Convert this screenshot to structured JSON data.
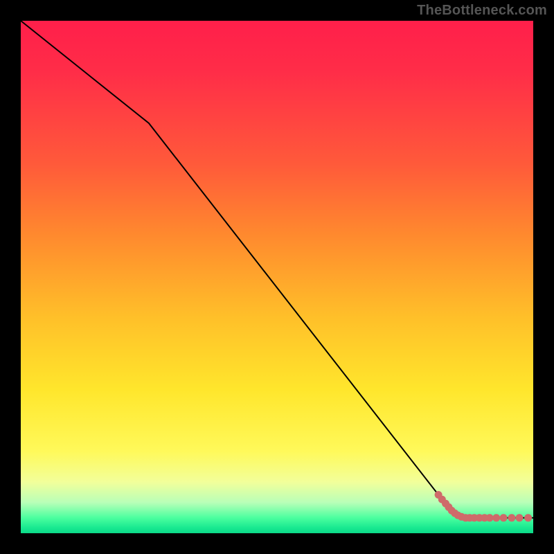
{
  "watermark": "TheBottleneck.com",
  "chart_data": {
    "type": "line",
    "title": "",
    "xlabel": "",
    "ylabel": "",
    "xlim": [
      0,
      100
    ],
    "ylim": [
      0,
      100
    ],
    "grid": false,
    "legend": false,
    "series": [
      {
        "name": "curve",
        "x": [
          0,
          25,
          85,
          100
        ],
        "values": [
          100,
          80,
          3,
          3
        ]
      }
    ],
    "scatter": {
      "name": "tail-points",
      "color": "#cf6a6a",
      "points": [
        {
          "x": 81.5,
          "y": 7.5
        },
        {
          "x": 82.2,
          "y": 6.6
        },
        {
          "x": 82.9,
          "y": 5.8
        },
        {
          "x": 83.5,
          "y": 5.1
        },
        {
          "x": 84.1,
          "y": 4.4
        },
        {
          "x": 84.7,
          "y": 3.9
        },
        {
          "x": 85.3,
          "y": 3.5
        },
        {
          "x": 86.0,
          "y": 3.2
        },
        {
          "x": 86.8,
          "y": 3.0
        },
        {
          "x": 87.6,
          "y": 3.0
        },
        {
          "x": 88.5,
          "y": 3.0
        },
        {
          "x": 89.5,
          "y": 3.0
        },
        {
          "x": 90.5,
          "y": 3.0
        },
        {
          "x": 91.5,
          "y": 3.0
        },
        {
          "x": 92.8,
          "y": 3.0
        },
        {
          "x": 94.2,
          "y": 3.0
        },
        {
          "x": 95.8,
          "y": 3.0
        },
        {
          "x": 97.3,
          "y": 3.0
        },
        {
          "x": 99.0,
          "y": 3.0
        }
      ]
    },
    "gradient_stops": [
      {
        "pos": 0,
        "color": "#ff1f4a"
      },
      {
        "pos": 28,
        "color": "#ff5a3a"
      },
      {
        "pos": 58,
        "color": "#ffc029"
      },
      {
        "pos": 84,
        "color": "#fff95a"
      },
      {
        "pos": 97,
        "color": "#4bff9f"
      },
      {
        "pos": 100,
        "color": "#0cd888"
      }
    ]
  }
}
